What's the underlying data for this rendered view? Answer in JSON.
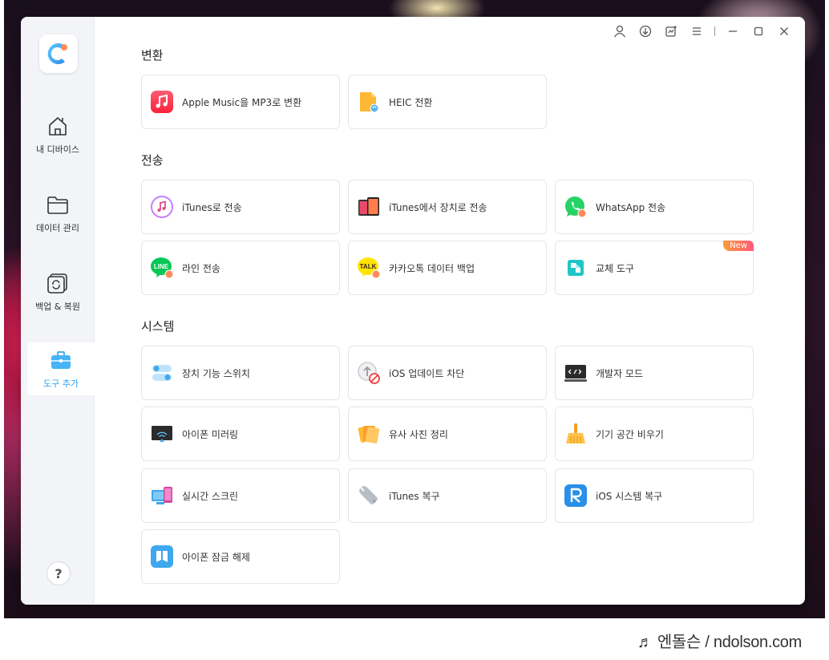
{
  "watermark": "♬ 엔돌슨 / ndolson.com",
  "sidebar": {
    "items": [
      {
        "label": "내 디바이스"
      },
      {
        "label": "데이터 관리"
      },
      {
        "label": "백업 & 복원"
      },
      {
        "label": "도구 추가"
      }
    ],
    "help_label": "?"
  },
  "sections": {
    "convert": {
      "title": "변환",
      "items": [
        {
          "label": "Apple Music을 MP3로 변환"
        },
        {
          "label": "HEIC 전환"
        }
      ]
    },
    "transfer": {
      "title": "전송",
      "items": [
        {
          "label": "iTunes로 전송"
        },
        {
          "label": "iTunes에서 장치로 전송"
        },
        {
          "label": "WhatsApp 전송"
        },
        {
          "label": "라인 전송"
        },
        {
          "label": "카카오톡 데이터 백업"
        },
        {
          "label": "교체 도구",
          "badge": "New"
        }
      ]
    },
    "system": {
      "title": "시스템",
      "items": [
        {
          "label": "장치 기능 스위치"
        },
        {
          "label": "iOS 업데이트 차단"
        },
        {
          "label": "개발자 모드"
        },
        {
          "label": "아이폰 미러링"
        },
        {
          "label": "유사 사진 정리"
        },
        {
          "label": "기기 공간 비우기"
        },
        {
          "label": "실시간 스크린"
        },
        {
          "label": "iTunes 복구"
        },
        {
          "label": "iOS 시스템 복구"
        },
        {
          "label": "아이폰 잠금 해제"
        }
      ]
    }
  },
  "icons": {
    "line_text": "LINE",
    "talk_text": "TALK"
  },
  "colors": {
    "accent": "#2e9ef0",
    "sidebar_bg": "#f2f4f7",
    "badge_start": "#ff9a3c",
    "badge_end": "#ff5a7a"
  }
}
